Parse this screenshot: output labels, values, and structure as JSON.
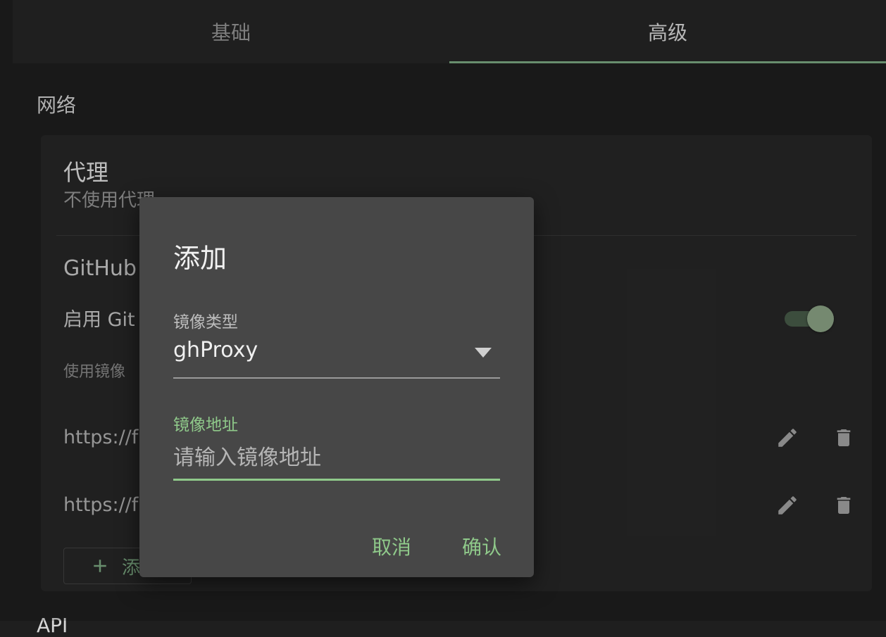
{
  "tabs": [
    {
      "label": "基础",
      "active": false
    },
    {
      "label": "高级",
      "active": true
    }
  ],
  "network": {
    "section_title": "网络",
    "proxy": {
      "title": "代理",
      "subtitle": "不使用代理"
    },
    "github": {
      "title": "GitHub",
      "enable_label": "启用 Git",
      "enabled": true,
      "hint": "使用镜像",
      "mirrors": [
        {
          "url": "https://f"
        },
        {
          "url": "https://f"
        }
      ],
      "add_label": "添"
    }
  },
  "api_section_title": "API",
  "dialog": {
    "title": "添加",
    "mirror_type": {
      "label": "镜像类型",
      "value": "ghProxy"
    },
    "mirror_address": {
      "label": "镜像地址",
      "placeholder": "请输入镜像地址",
      "value": ""
    },
    "cancel_label": "取消",
    "confirm_label": "确认"
  },
  "colors": {
    "accent": "#8fc98a",
    "tab_indicator": "#7fae86",
    "background": "#1f1f1f",
    "card": "#282828",
    "dialog": "#474747"
  }
}
